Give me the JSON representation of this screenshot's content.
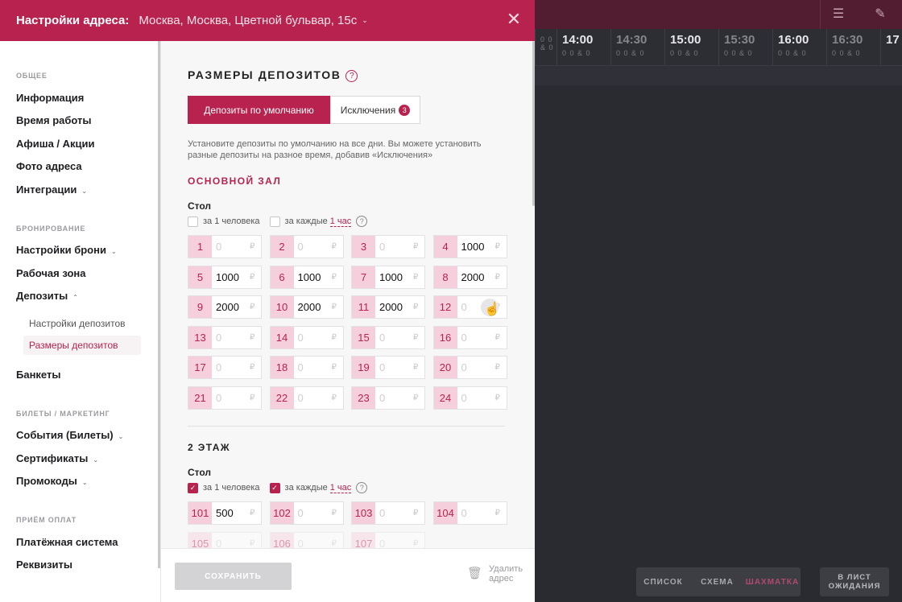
{
  "header": {
    "title": "Настройки адреса:",
    "address": "Москва, Москва, Цветной бульвар, 15с"
  },
  "sidebar": {
    "sections": {
      "general": "ОБЩЕЕ",
      "booking": "БРОНИРОВАНИЕ",
      "tickets": "БИЛЕТЫ / МАРКЕТИНГ",
      "payments": "ПРИЁМ ОПЛАТ"
    },
    "items": {
      "info": "Информация",
      "hours": "Время работы",
      "afisha": "Афиша / Акции",
      "photo": "Фото адреса",
      "integrations": "Интеграции",
      "booking_settings": "Настройки брони",
      "workzone": "Рабочая зона",
      "deposits": "Депозиты",
      "deposit_settings": "Настройки депозитов",
      "deposit_sizes": "Размеры депозитов",
      "banquets": "Банкеты",
      "events": "События (Билеты)",
      "certificates": "Сертификаты",
      "promocodes": "Промокоды",
      "payment_system": "Платёжная система",
      "requisites": "Реквизиты"
    }
  },
  "content": {
    "title": "РАЗМЕРЫ ДЕПОЗИТОВ",
    "help": "?",
    "tab_default": "Депозиты по умолчанию",
    "tab_exceptions": "Исключения",
    "exceptions_count": "3",
    "description": "Установите депозиты по умолчанию на все дни. Вы можете установить разные депозиты на разное время, добавив «Исключения»",
    "zone1": {
      "name": "ОСНОВНОЙ ЗАЛ",
      "label": "Стол",
      "per_person": "за 1 человека",
      "per_each": "за каждые",
      "hour": "1 час",
      "tables": [
        {
          "n": "1",
          "v": "0",
          "set": false
        },
        {
          "n": "2",
          "v": "0",
          "set": false
        },
        {
          "n": "3",
          "v": "0",
          "set": false
        },
        {
          "n": "4",
          "v": "1000",
          "set": true
        },
        {
          "n": "5",
          "v": "1000",
          "set": true
        },
        {
          "n": "6",
          "v": "1000",
          "set": true
        },
        {
          "n": "7",
          "v": "1000",
          "set": true
        },
        {
          "n": "8",
          "v": "2000",
          "set": true
        },
        {
          "n": "9",
          "v": "2000",
          "set": true
        },
        {
          "n": "10",
          "v": "2000",
          "set": true
        },
        {
          "n": "11",
          "v": "2000",
          "set": true
        },
        {
          "n": "12",
          "v": "0",
          "set": false
        },
        {
          "n": "13",
          "v": "0",
          "set": false
        },
        {
          "n": "14",
          "v": "0",
          "set": false
        },
        {
          "n": "15",
          "v": "0",
          "set": false
        },
        {
          "n": "16",
          "v": "0",
          "set": false
        },
        {
          "n": "17",
          "v": "0",
          "set": false
        },
        {
          "n": "18",
          "v": "0",
          "set": false
        },
        {
          "n": "19",
          "v": "0",
          "set": false
        },
        {
          "n": "20",
          "v": "0",
          "set": false
        },
        {
          "n": "21",
          "v": "0",
          "set": false
        },
        {
          "n": "22",
          "v": "0",
          "set": false
        },
        {
          "n": "23",
          "v": "0",
          "set": false
        },
        {
          "n": "24",
          "v": "0",
          "set": false
        }
      ]
    },
    "zone2": {
      "name": "2 ЭТАЖ",
      "label": "Стол",
      "per_person": "за 1 человека",
      "per_each": "за каждые",
      "hour": "1 час",
      "tables": [
        {
          "n": "101",
          "v": "500",
          "set": true
        },
        {
          "n": "102",
          "v": "0",
          "set": false
        },
        {
          "n": "103",
          "v": "0",
          "set": false
        },
        {
          "n": "104",
          "v": "0",
          "set": false
        },
        {
          "n": "105",
          "v": "0",
          "set": false
        },
        {
          "n": "106",
          "v": "0",
          "set": false
        },
        {
          "n": "107",
          "v": "0",
          "set": false
        }
      ]
    },
    "currency": "₽"
  },
  "footer": {
    "save": "СОХРАНИТЬ",
    "delete_line1": "Удалить",
    "delete_line2": "адрес"
  },
  "background": {
    "times": [
      "14:00",
      "14:30",
      "15:00",
      "15:30",
      "16:00",
      "16:30",
      "17"
    ],
    "stats": "0 0 & 0",
    "view_list": "СПИСОК",
    "view_scheme": "СХЕМА",
    "view_chess": "ШАХМАТКА",
    "waitlist_line1": "В ЛИСТ",
    "waitlist_line2": "ОЖИДАНИЯ"
  },
  "colors": {
    "accent": "#b8224e",
    "dark_bg": "#2a2a31"
  }
}
